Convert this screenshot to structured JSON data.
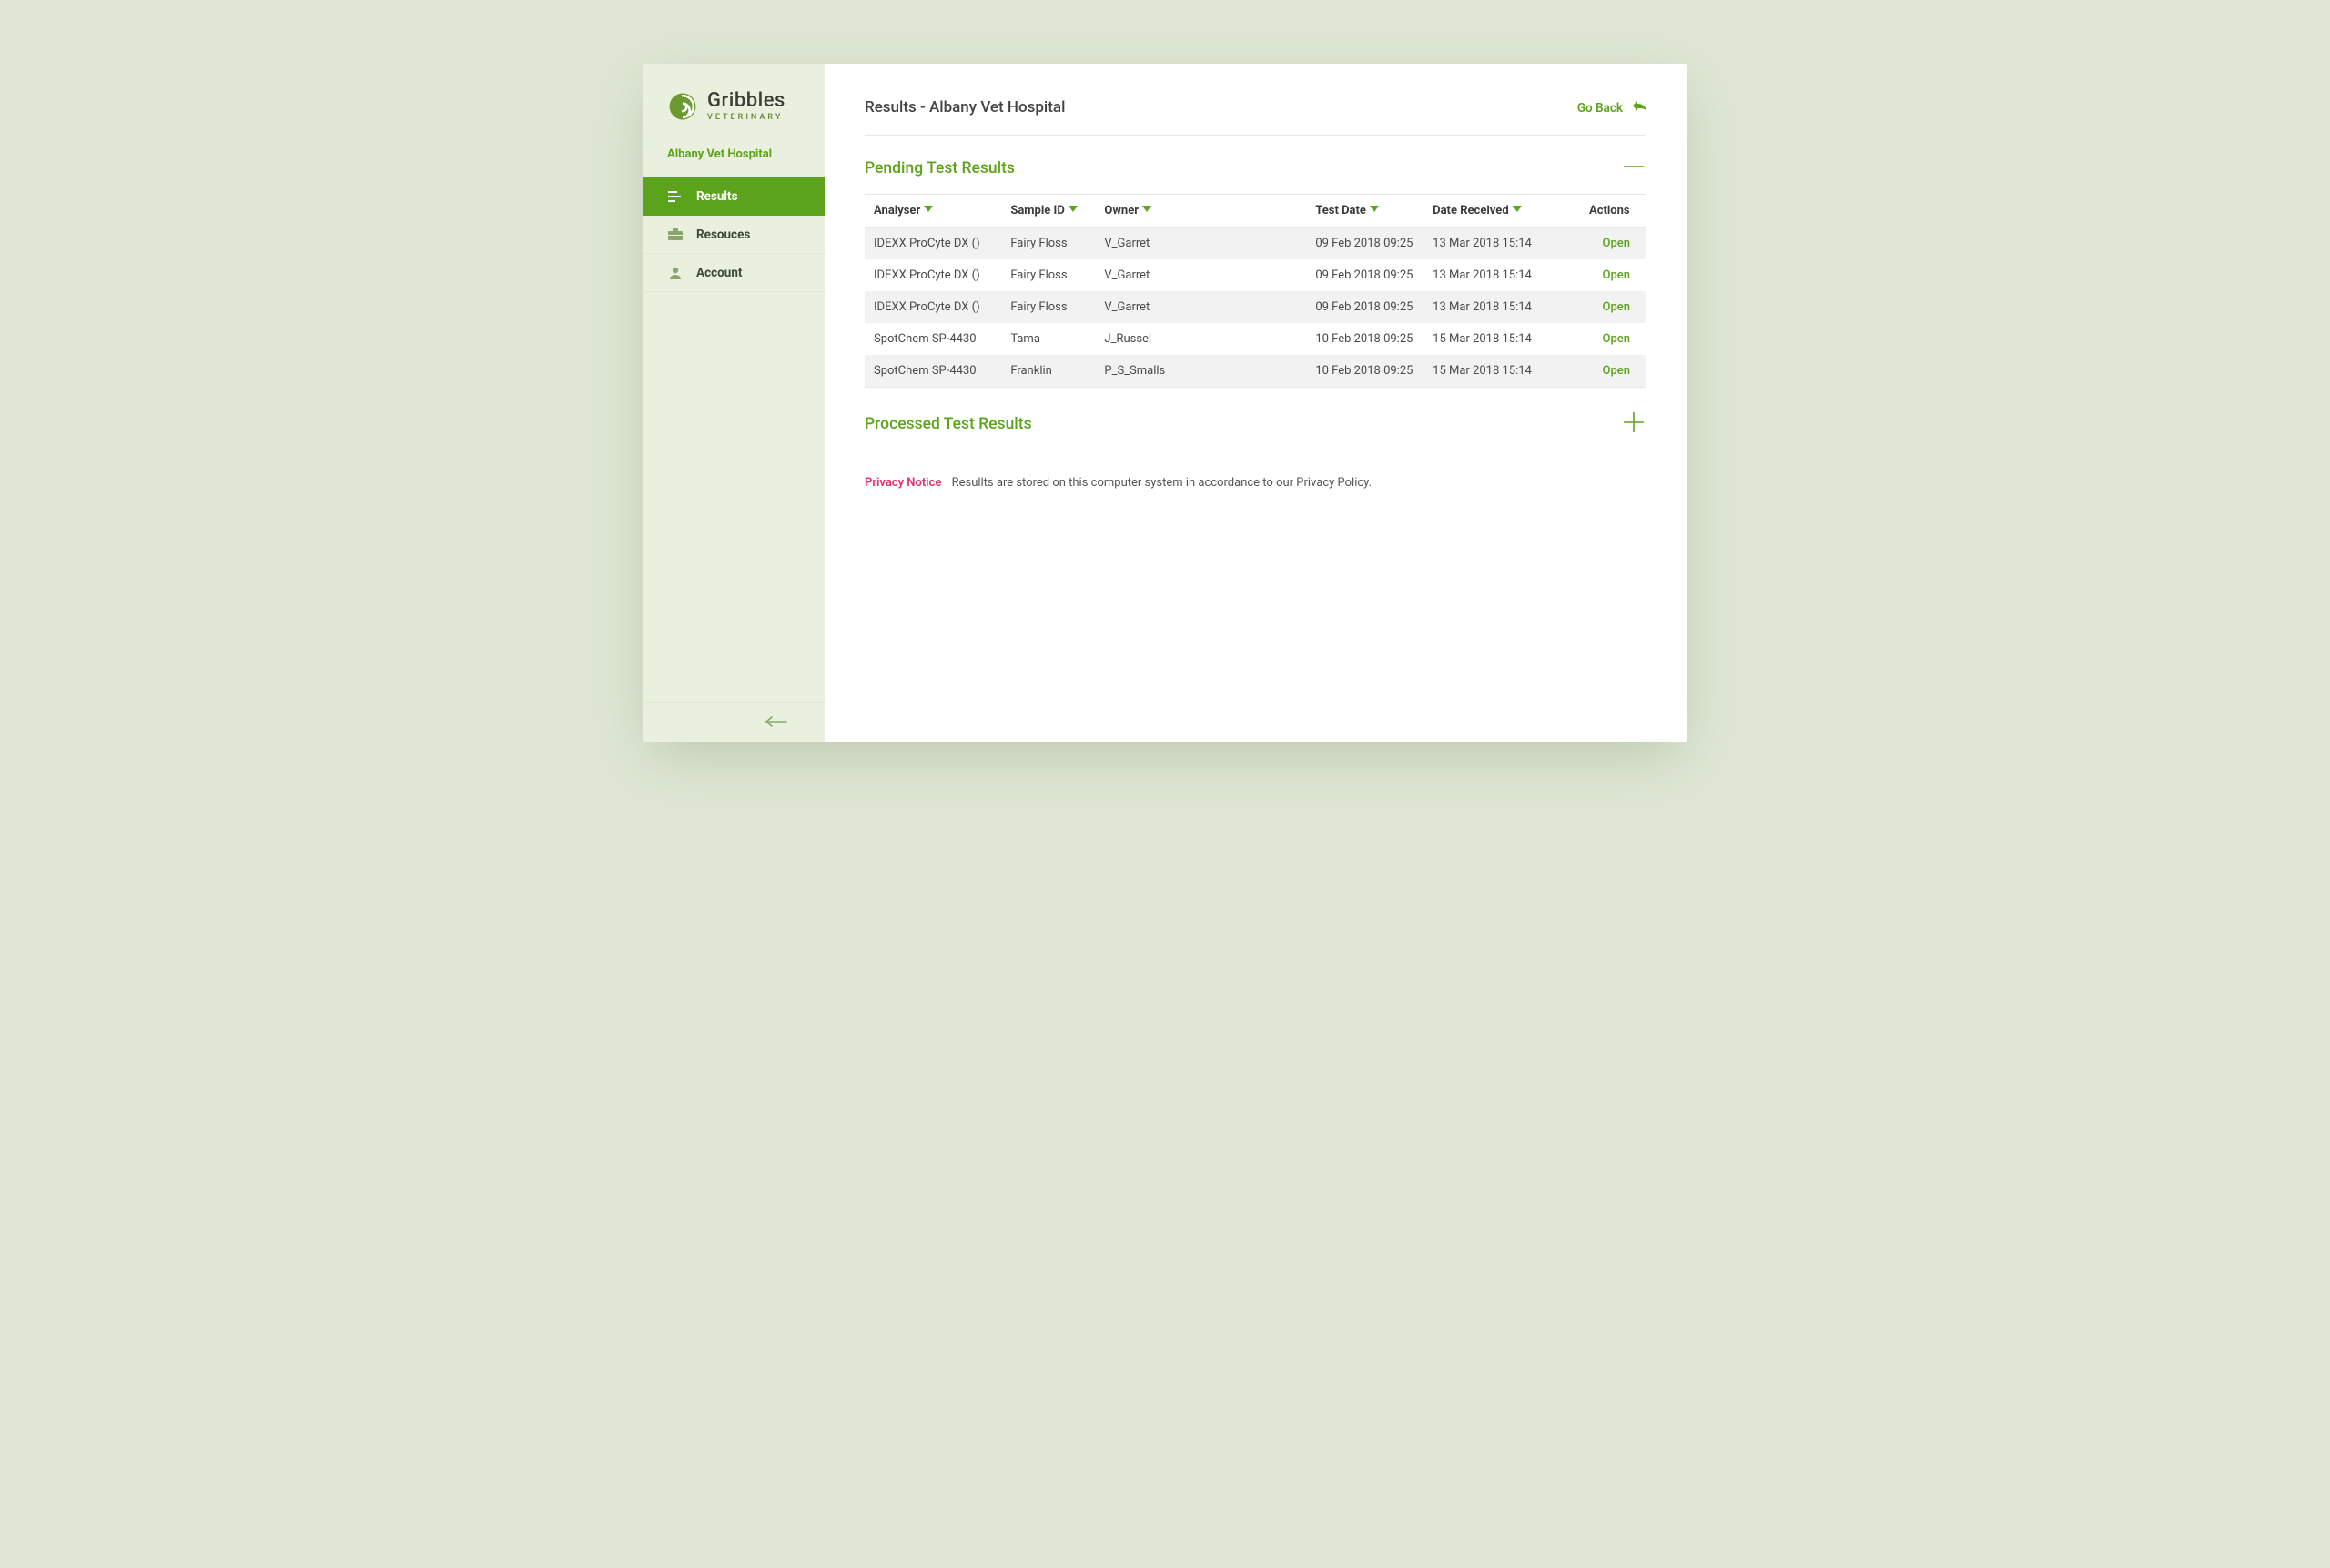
{
  "brand": {
    "name": "Gribbles",
    "sub": "VETERINARY"
  },
  "org": "Albany Vet Hospital",
  "nav": {
    "results": "Results",
    "resources": "Resouces",
    "account": "Account"
  },
  "header": {
    "title": "Results - Albany Vet Hospital",
    "back": "Go Back"
  },
  "sections": {
    "pending_title": "Pending Test Results",
    "processed_title": "Processed Test Results"
  },
  "table": {
    "columns": {
      "analyser": "Analyser",
      "sample_id": "Sample ID",
      "owner": "Owner",
      "test_date": "Test Date",
      "date_received": "Date Received",
      "actions": "Actions"
    },
    "action_label": "Open",
    "rows": [
      {
        "analyser": "IDEXX ProCyte DX ()",
        "sample_id": "Fairy Floss",
        "owner": "V_Garret",
        "test_date": "09 Feb 2018 09:25",
        "date_received": "13 Mar 2018 15:14"
      },
      {
        "analyser": "IDEXX ProCyte DX ()",
        "sample_id": "Fairy Floss",
        "owner": "V_Garret",
        "test_date": "09 Feb 2018 09:25",
        "date_received": "13 Mar 2018 15:14"
      },
      {
        "analyser": "IDEXX ProCyte DX ()",
        "sample_id": "Fairy Floss",
        "owner": "V_Garret",
        "test_date": "09 Feb 2018 09:25",
        "date_received": "13 Mar 2018 15:14"
      },
      {
        "analyser": "SpotChem SP-4430",
        "sample_id": "Tama",
        "owner": "J_Russel",
        "test_date": "10 Feb 2018 09:25",
        "date_received": "15 Mar 2018 15:14"
      },
      {
        "analyser": "SpotChem SP-4430",
        "sample_id": "Franklin",
        "owner": "P_S_Smalls",
        "test_date": "10 Feb 2018 09:25",
        "date_received": "15 Mar 2018 15:14"
      }
    ]
  },
  "privacy": {
    "label": "Privacy Notice",
    "text": "Resullts are stored on this computer system in accordance to our Privacy Policy."
  },
  "colors": {
    "accent": "#5da41d",
    "sidebar": "#eaf0de",
    "page_bg": "#dfe7d4"
  }
}
